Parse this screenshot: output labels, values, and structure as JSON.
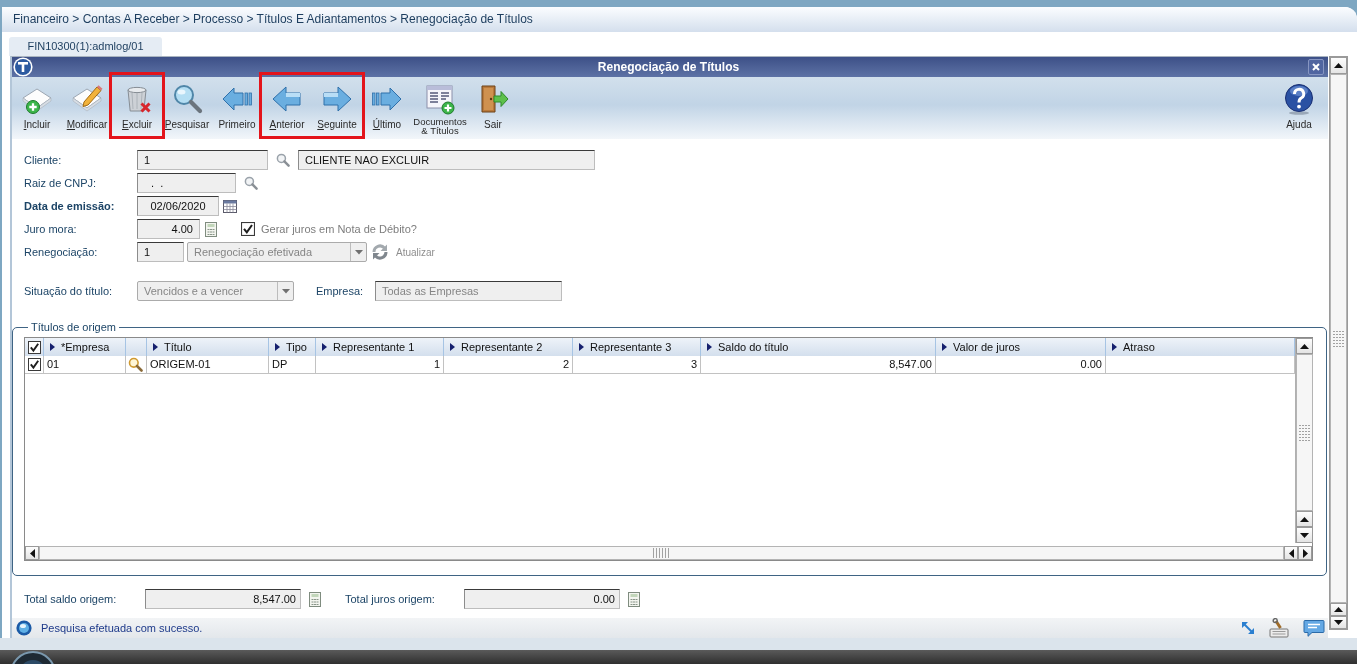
{
  "breadcrumb": {
    "text": "Financeiro > Contas A Receber > Processo > Títulos E Adiantamentos > Renegociação de Títulos"
  },
  "tabs": [
    {
      "label": "FIN10300(1):admlog/01",
      "selected": true
    }
  ],
  "window": {
    "title": "Renegociação de Títulos"
  },
  "toolbar": {
    "buttons": [
      {
        "kind": "add",
        "label": "Incluir",
        "mnemonic": true,
        "highlighted": false
      },
      {
        "kind": "edit",
        "label": "Modificar",
        "mnemonic": true,
        "highlighted": false
      },
      {
        "kind": "delete",
        "label": "Excluir",
        "mnemonic": true,
        "highlighted": true
      },
      {
        "kind": "search",
        "label": "Pesquisar",
        "mnemonic": true,
        "highlighted": false
      },
      {
        "kind": "first",
        "label": "Primeiro",
        "mnemonic": false,
        "highlighted": false
      },
      {
        "kind": "previous",
        "label": "Anterior",
        "mnemonic": true,
        "highlighted": true
      },
      {
        "kind": "next",
        "label": "Seguinte",
        "mnemonic": true,
        "highlighted": true
      },
      {
        "kind": "last",
        "label": "Último",
        "mnemonic": true,
        "highlighted": false
      },
      {
        "kind": "documents",
        "label": "Documentos & Títulos",
        "mnemonic": false,
        "highlighted": false
      },
      {
        "kind": "exit",
        "label": "Sair",
        "mnemonic": false,
        "highlighted": false
      },
      {
        "kind": "help",
        "label": "Ajuda",
        "mnemonic": false,
        "highlighted": false
      }
    ]
  },
  "form": {
    "client": {
      "label": "Cliente:",
      "code": "1",
      "name": "CLIENTE NAO EXCLUIR"
    },
    "cnpj_root": {
      "label": "Raiz de CNPJ:",
      "value": ".  ."
    },
    "issue_date": {
      "label": "Data de emissão:",
      "value": "02/06/2020",
      "required": true
    },
    "late_interest": {
      "label": "Juro mora:",
      "value": "4.00"
    },
    "debit_note_interest": {
      "label": "Gerar juros em Nota de Débito?",
      "checked": true
    },
    "renegotiation": {
      "label": "Renegociação:",
      "number": "1",
      "status": {
        "value": "Renegociação efetivada",
        "disabled": true
      },
      "refresh": {
        "label": "Atualizar",
        "disabled": true
      }
    },
    "title_situation": {
      "label": "Situação do título:",
      "value": "Vencidos e a vencer",
      "disabled": true
    },
    "company": {
      "label": "Empresa:",
      "value": "Todas as Empresas",
      "disabled": true
    }
  },
  "origin_titles": {
    "legend": "Títulos de origem",
    "all_checked": true,
    "columns": [
      {
        "kind": "text",
        "label": "*Empresa"
      },
      {
        "kind": "lookup"
      },
      {
        "kind": "text",
        "label": "Título"
      },
      {
        "kind": "text",
        "label": "Tipo"
      },
      {
        "kind": "number",
        "label": "Representante 1"
      },
      {
        "kind": "number",
        "label": "Representante 2"
      },
      {
        "kind": "number",
        "label": "Representante 3"
      },
      {
        "kind": "number",
        "label": "Saldo do título"
      },
      {
        "kind": "number",
        "label": "Valor de juros"
      },
      {
        "kind": "text",
        "label": "Atraso"
      }
    ],
    "rows": [
      {
        "checked": true,
        "cells": [
          "01",
          "",
          "ORIGEM-01",
          "DP",
          "1",
          "2",
          "3",
          "8,547.00",
          "0.00",
          ""
        ]
      }
    ]
  },
  "totals": [
    {
      "label": "Total saldo origem:",
      "value": "8,547.00"
    },
    {
      "label": "Total juros origem:",
      "value": "0.00"
    }
  ],
  "status_bar": {
    "message": "Pesquisa efetuada com sucesso."
  }
}
